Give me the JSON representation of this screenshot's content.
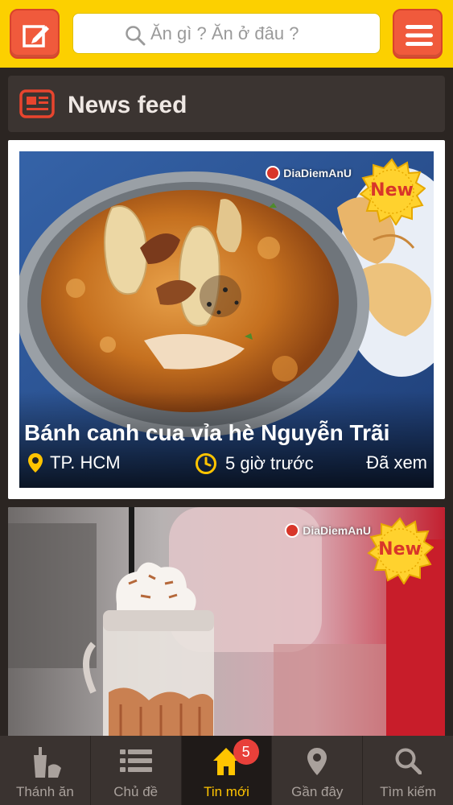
{
  "header": {
    "search_placeholder": "Ăn gì ? Ăn ở đâu ?",
    "write_icon": "edit-icon",
    "menu_icon": "hamburger-menu-icon"
  },
  "section": {
    "title": "News feed",
    "icon": "newspaper-icon"
  },
  "posts": [
    {
      "title": "Bánh canh cua vỉa hè Nguyễn Trãi",
      "location": "TP. HCM",
      "time": "5 giờ trước",
      "status": "Đã xem",
      "badge": "New",
      "watermark": "DiaDiemAnU"
    },
    {
      "badge": "New",
      "watermark": "DiaDiemAnU"
    }
  ],
  "tabs": [
    {
      "label": "Thánh ăn",
      "icon": "drink-icon"
    },
    {
      "label": "Chủ đề",
      "icon": "list-icon"
    },
    {
      "label": "Tin mới",
      "icon": "home-icon",
      "badge": "5",
      "active": true
    },
    {
      "label": "Gần đây",
      "icon": "location-pin-icon"
    },
    {
      "label": "Tìm kiếm",
      "icon": "search-icon"
    }
  ],
  "colors": {
    "header_bg": "#fcd000",
    "accent_red": "#f05a3c",
    "active_tab": "#ffc400",
    "badge_red": "#e8403a"
  }
}
